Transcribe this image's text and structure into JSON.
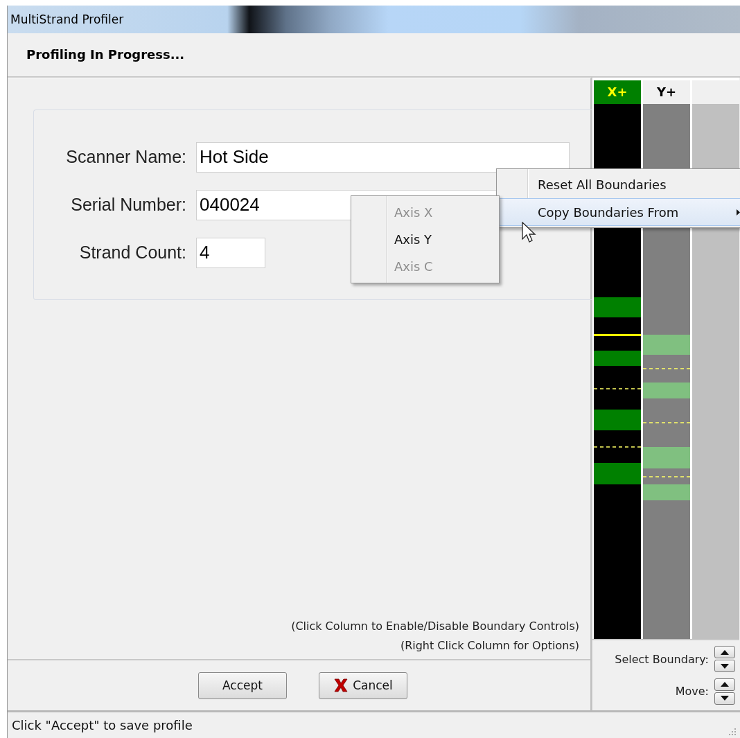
{
  "window": {
    "title": "MultiStrand Profiler"
  },
  "header": "Profiling In Progress...",
  "fields": [
    {
      "label": "Scanner Name:",
      "value": "Hot Side",
      "kind": "wide"
    },
    {
      "label": "Serial Number:",
      "value": "040024",
      "kind": "wide"
    },
    {
      "label": "Strand Count:",
      "value": "4",
      "kind": "narrow"
    }
  ],
  "hints": [
    "(Click Column to Enable/Disable Boundary Controls)",
    "(Right Click Column for Options)"
  ],
  "buttons": [
    {
      "label": "Accept",
      "kind": "plain"
    },
    {
      "label": "Cancel",
      "kind": "cancel"
    }
  ],
  "columns": [
    {
      "label": "X+",
      "enabled": true
    },
    {
      "label": "Y+",
      "enabled": false
    },
    {
      "enabled": false
    }
  ],
  "controls": [
    {
      "label": "Select Boundary:"
    },
    {
      "label": "Move:"
    }
  ],
  "context_menu": {
    "items": [
      {
        "label": "Reset All Boundaries",
        "highlighted": false,
        "has_submenu": false
      },
      {
        "label": "Copy Boundaries From",
        "highlighted": true,
        "has_submenu": true
      }
    ]
  },
  "submenu": {
    "items": [
      {
        "label": "Axis X",
        "disabled": true
      },
      {
        "label": "Axis Y",
        "disabled": false
      },
      {
        "label": "Axis C",
        "disabled": true
      }
    ]
  },
  "status_bar": "Click \"Accept\" to save profile"
}
